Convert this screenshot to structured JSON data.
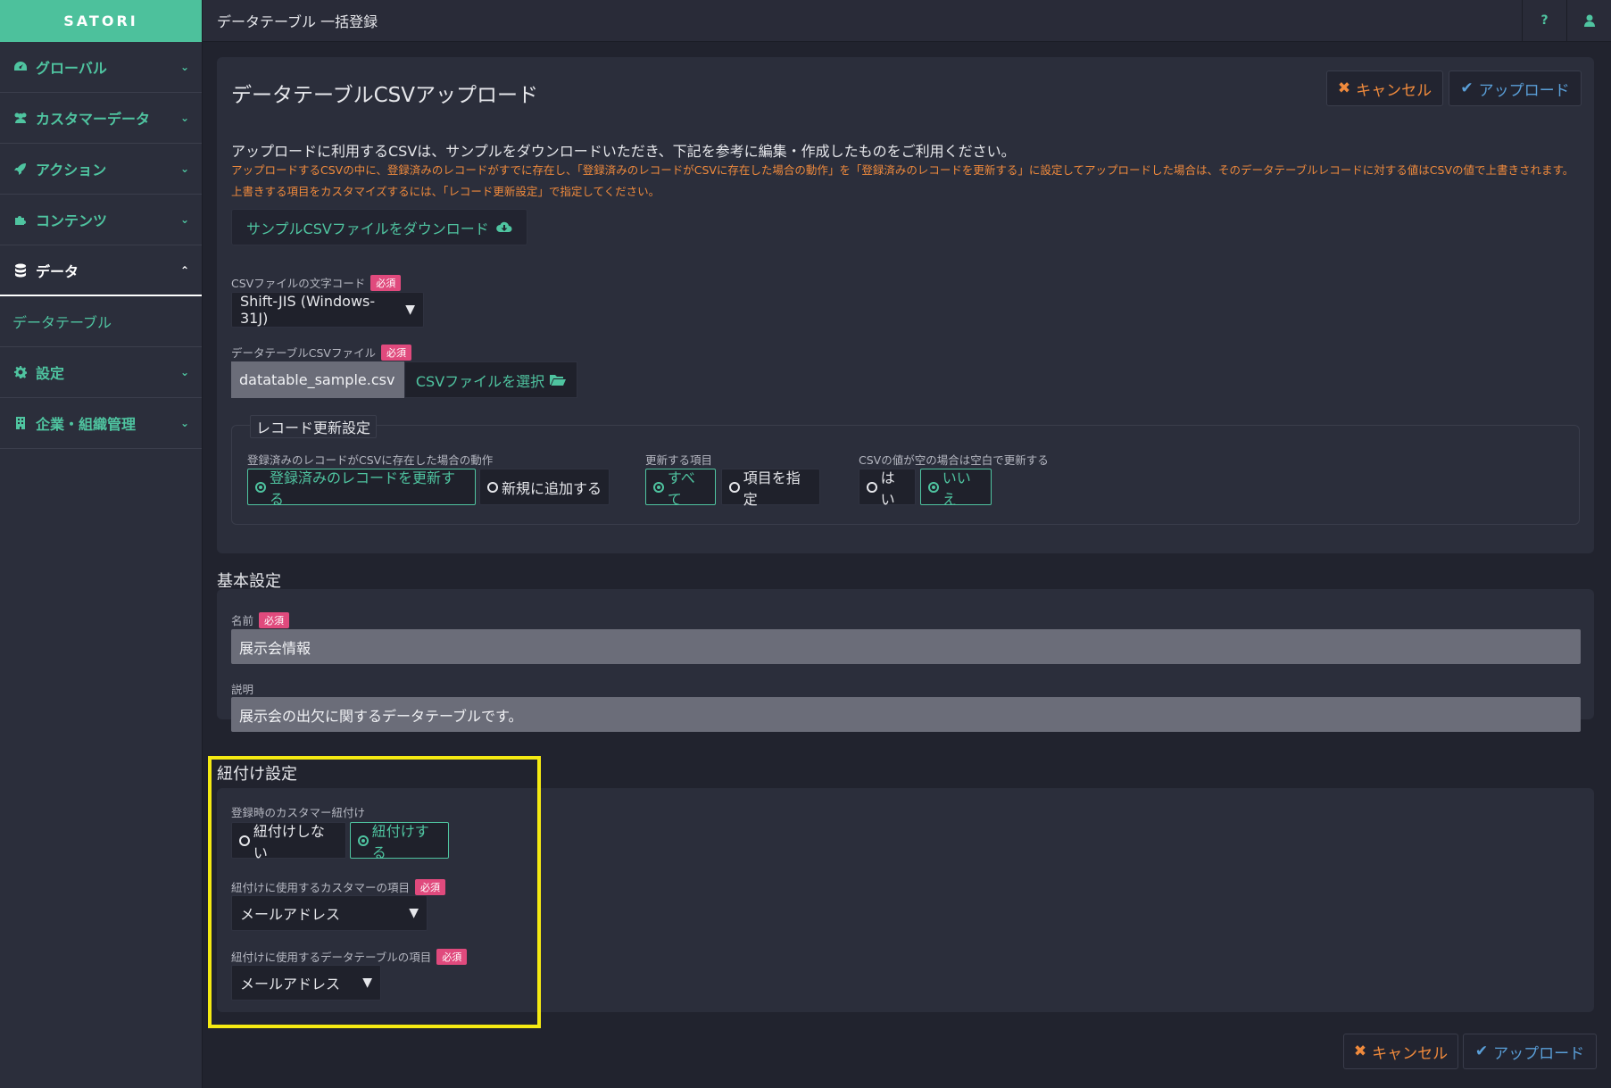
{
  "app": {
    "brand": "SATORI",
    "page_title": "データテーブル 一括登録",
    "help_label": "?",
    "colors": {
      "accent": "#4dc19c",
      "warn": "#f08a3c",
      "upload": "#5a9fd8",
      "required": "#e04a7d",
      "highlight": "#f5ea12"
    }
  },
  "sidebar": {
    "items": [
      {
        "label": "グローバル",
        "icon": "dashboard-icon"
      },
      {
        "label": "カスタマーデータ",
        "icon": "users-icon"
      },
      {
        "label": "アクション",
        "icon": "rocket-icon"
      },
      {
        "label": "コンテンツ",
        "icon": "puzzle-icon"
      },
      {
        "label": "データ",
        "icon": "database-icon"
      },
      {
        "label": "設定",
        "icon": "gear-icon"
      },
      {
        "label": "企業・組織管理",
        "icon": "building-icon"
      }
    ],
    "sub_items": [
      {
        "label": "データテーブル"
      }
    ]
  },
  "upload": {
    "title": "データテーブルCSVアップロード",
    "cancel_label": "キャンセル",
    "upload_label": "アップロード",
    "description": "アップロードに利用するCSVは、サンプルをダウンロードいただき、下記を参考に編集・作成したものをご利用ください。",
    "warning": "アップロードするCSVの中に、登録済みのレコードがすでに存在し、「登録済みのレコードがCSVに存在した場合の動作」を「登録済みのレコードを更新する」に設定してアップロードした場合は、そのデータテーブルレコードに対する値はCSVの値で上書きされます。上書きする項目をカスタマイズするには、「レコード更新設定」で指定してください。",
    "download_label": "サンプルCSVファイルをダウンロード",
    "required_label": "必須",
    "encoding": {
      "label": "CSVファイルの文字コード",
      "value": "Shift-JIS (Windows-31J)"
    },
    "file": {
      "label": "データテーブルCSVファイル",
      "name": "datatable_sample.csv",
      "button_label": "CSVファイルを選択"
    },
    "record_update": {
      "legend": "レコード更新設定",
      "action_label": "登録済みのレコードがCSVに存在した場合の動作",
      "action_options": [
        "登録済みのレコードを更新する",
        "新規に追加する"
      ],
      "items_label": "更新する項目",
      "items_options": [
        "すべて",
        "項目を指定"
      ],
      "empty_label": "CSVの値が空の場合は空白で更新する",
      "empty_options": [
        "はい",
        "いいえ"
      ]
    }
  },
  "basic": {
    "title": "基本設定",
    "name_label": "名前",
    "name_value": "展示会情報",
    "desc_label": "説明",
    "desc_value": "展示会の出欠に関するデータテーブルです。"
  },
  "link": {
    "title": "紐付け設定",
    "customer_link_label": "登録時のカスタマー紐付け",
    "customer_link_options": [
      "紐付けしない",
      "紐付けする"
    ],
    "customer_field_label": "紐付けに使用するカスタマーの項目",
    "customer_field_value": "メールアドレス",
    "table_field_label": "紐付けに使用するデータテーブルの項目",
    "table_field_value": "メールアドレス"
  },
  "footer": {
    "cancel_label": "キャンセル",
    "upload_label": "アップロード"
  }
}
